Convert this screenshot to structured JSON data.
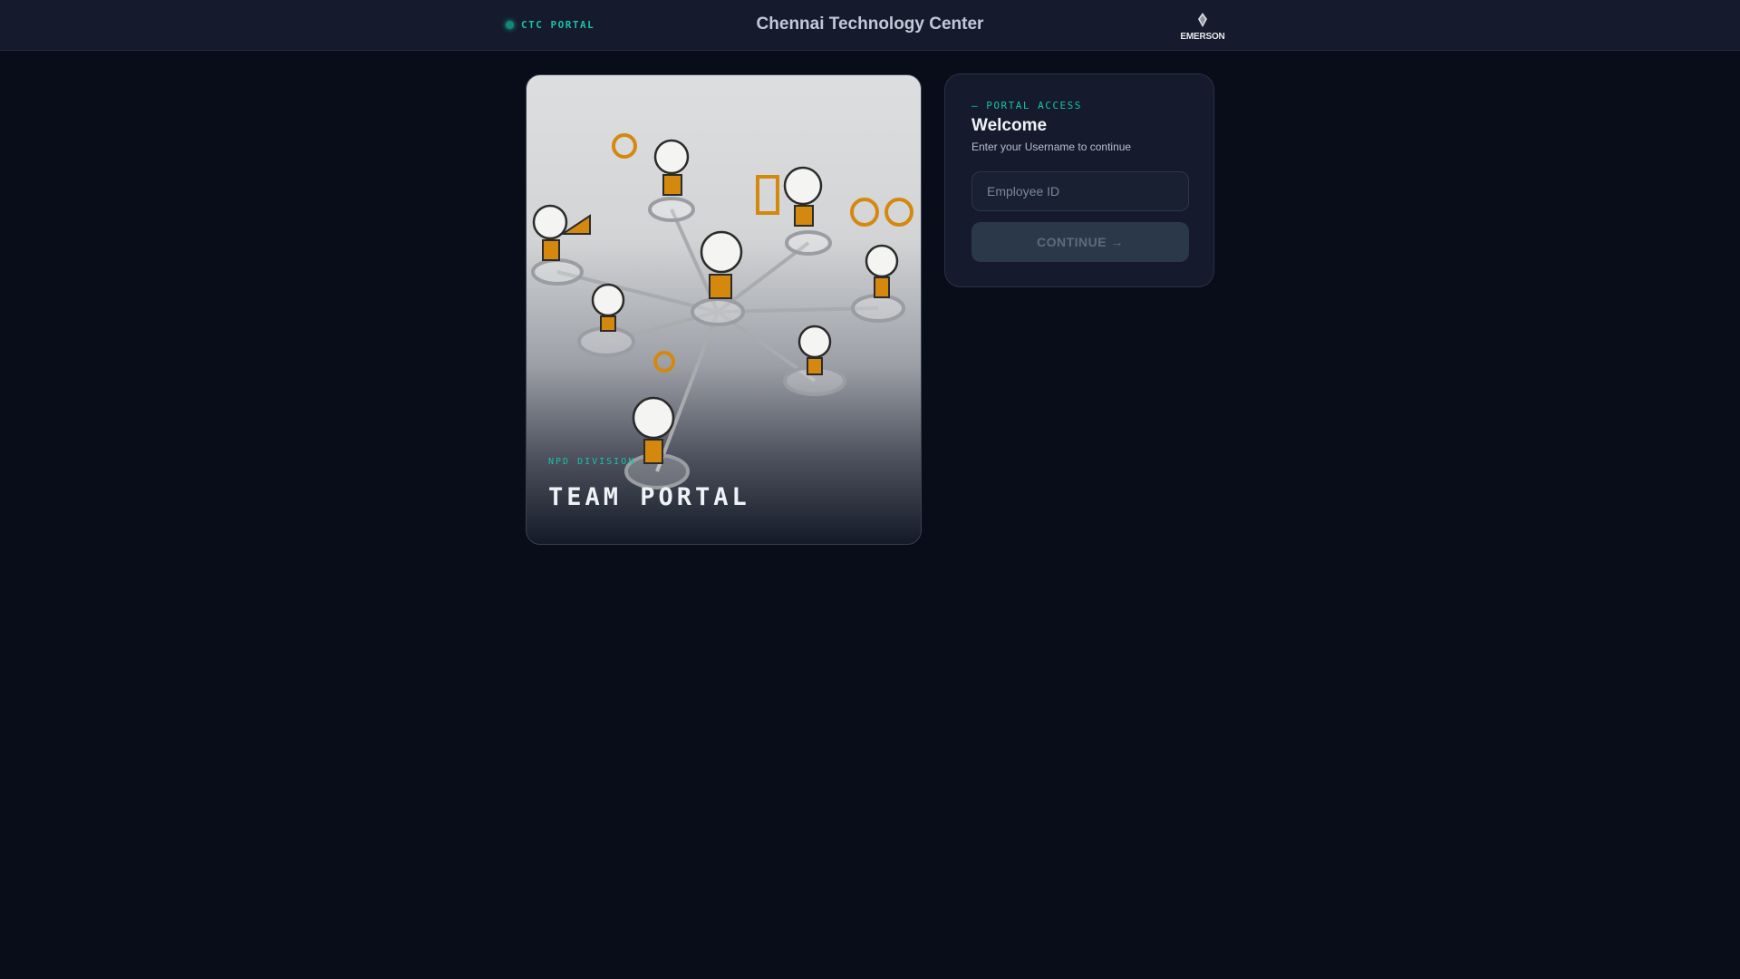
{
  "header": {
    "brand": "CTC PORTAL",
    "title": "Chennai Technology Center",
    "logo_text": "EMERSON"
  },
  "hero": {
    "subtitle": "NPD DIVISION",
    "title": "TEAM PORTAL"
  },
  "login": {
    "kicker": "— PORTAL ACCESS",
    "heading": "Welcome",
    "subtitle": "Enter your Username to continue",
    "input_placeholder": "Employee ID",
    "input_value": "",
    "button_label": "CONTINUE →"
  },
  "colors": {
    "accent": "#19c2a8",
    "background": "#080d19",
    "card": "#151b2c",
    "illustration_orange": "#d4890e"
  }
}
